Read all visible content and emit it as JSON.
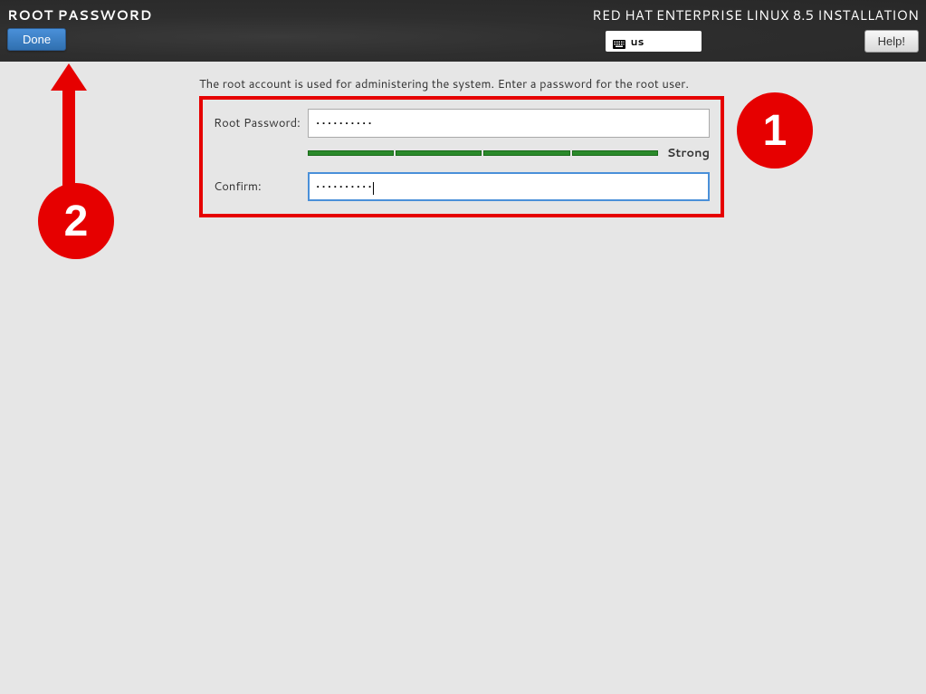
{
  "header": {
    "screen_title": "ROOT PASSWORD",
    "done_label": "Done",
    "install_title": "RED HAT ENTERPRISE LINUX 8.5 INSTALLATION",
    "keyboard_layout": "us",
    "help_label": "Help!"
  },
  "content": {
    "instruction": "The root account is used for administering the system.  Enter a password for the root user.",
    "root_password_label": "Root Password:",
    "root_password_value": "••••••••••",
    "confirm_label": "Confirm:",
    "confirm_value": "••••••••••",
    "strength_label": "Strong"
  },
  "annotations": {
    "step1": "1",
    "step2": "2"
  }
}
